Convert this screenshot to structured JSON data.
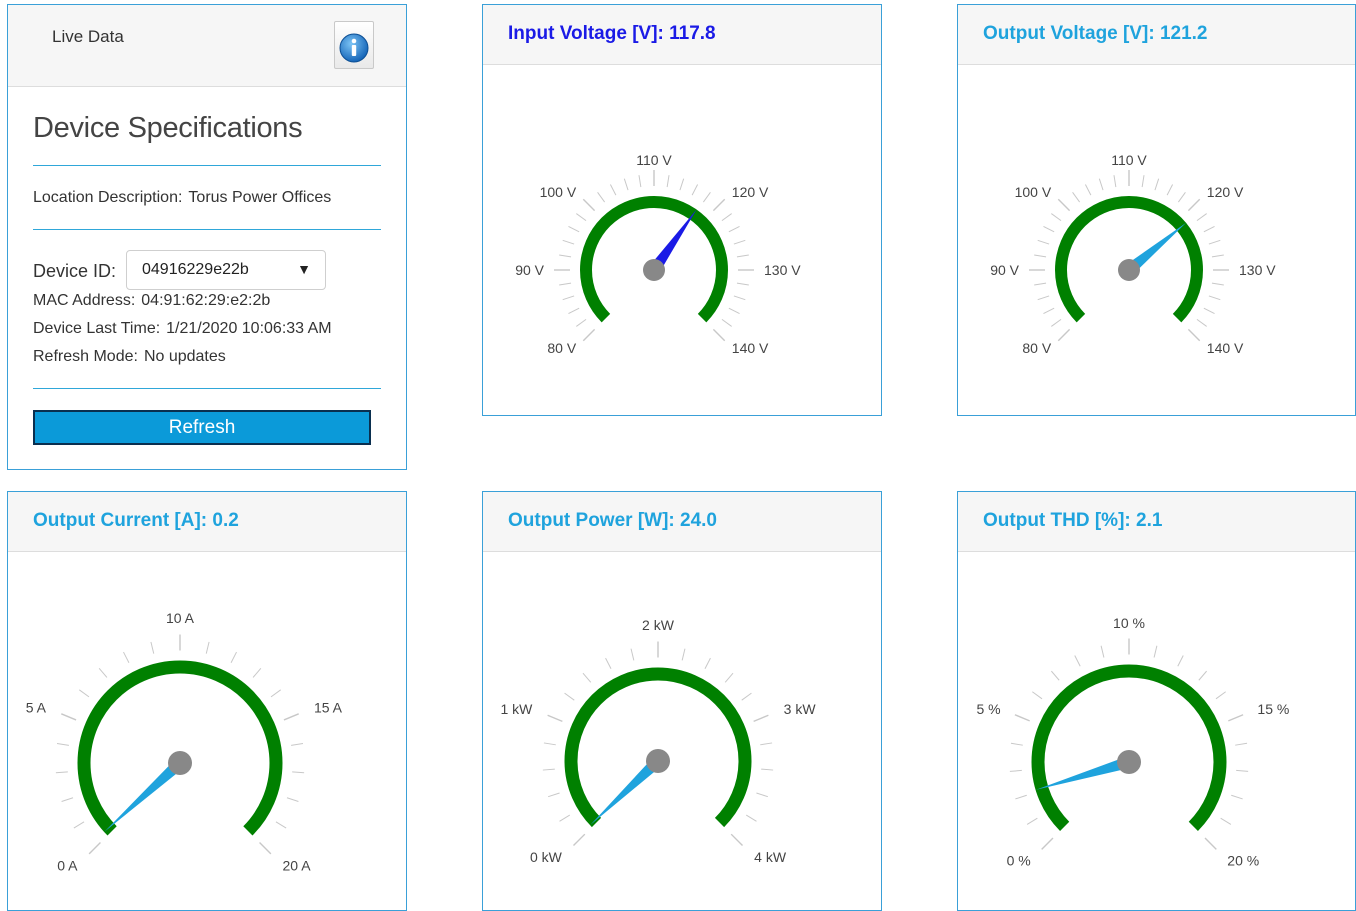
{
  "live": {
    "title": "Live Data",
    "spec_title": "Device Specifications",
    "location_label": "Location Description:",
    "location_value": "Torus Power Offices",
    "device_id_label": "Device ID:",
    "device_id_value": "04916229e22b",
    "mac_label": "MAC Address:",
    "mac_value": "04:91:62:29:e2:2b",
    "time_label": "Device Last Time:",
    "time_value": "1/21/2020 10:06:33 AM",
    "refresh_mode_label": "Refresh Mode:",
    "refresh_mode_value": "No updates",
    "refresh_button": "Refresh"
  },
  "gauges": {
    "input_voltage": {
      "title": "Input Voltage [V]: 117.8",
      "value": 117.8,
      "min": 80,
      "max": 140,
      "labels": [
        "80 V",
        "90 V",
        "100 V",
        "110 V",
        "120 V",
        "130 V",
        "140 V"
      ],
      "needle_color": "#1a1ae6"
    },
    "output_voltage": {
      "title": "Output Voltage [V]: 121.2",
      "value": 121.2,
      "min": 80,
      "max": 140,
      "labels": [
        "80 V",
        "90 V",
        "100 V",
        "110 V",
        "120 V",
        "130 V",
        "140 V"
      ],
      "needle_color": "#1fa3dd"
    },
    "output_current": {
      "title": "Output Current [A]: 0.2",
      "value": 0.2,
      "min": 0,
      "max": 20,
      "labels": [
        "0 A",
        "5 A",
        "10 A",
        "15 A",
        "20 A"
      ],
      "needle_color": "#1fa3dd"
    },
    "output_power": {
      "title": "Output Power [W]: 24.0",
      "value": 0.024,
      "min": 0,
      "max": 4,
      "labels": [
        "0 kW",
        "1 kW",
        "2 kW",
        "3 kW",
        "4 kW"
      ],
      "needle_color": "#1fa3dd"
    },
    "output_thd": {
      "title": "Output THD [%]: 2.1",
      "value": 2.1,
      "min": 0,
      "max": 20,
      "labels": [
        "0 %",
        "5 %",
        "10 %",
        "15 %",
        "20 %"
      ],
      "needle_color": "#1fa3dd"
    }
  },
  "colors": {
    "arc": "#008000",
    "hub": "#888888",
    "tick": "#c8c8c8",
    "accent": "#1fa3dd",
    "border": "#3aa0d8"
  },
  "icons": {
    "info": "info-icon",
    "dropdown": "chevron-down-icon"
  }
}
